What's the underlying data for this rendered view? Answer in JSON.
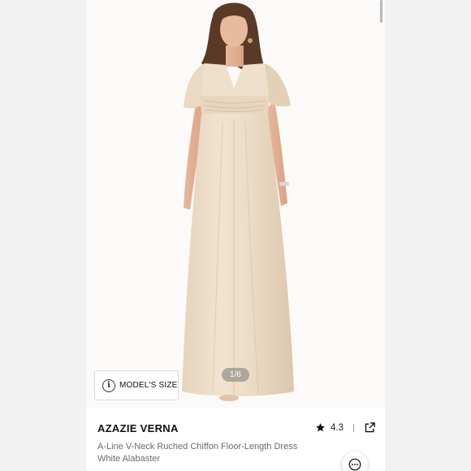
{
  "gallery": {
    "counter": "1/6",
    "model_size_label": "MODEL'S SIZE"
  },
  "product": {
    "title": "AZAZIE VERNA",
    "description_line1": "A-Line V-Neck Ruched Chiffon Floor-Length Dress",
    "description_line2": "White Alabaster",
    "rating": "4.3"
  },
  "icons": {
    "info": "info-icon",
    "star": "star-icon",
    "share": "share-external-icon",
    "chat": "chat-bubble-icon"
  },
  "colors": {
    "dress": "#ecdcc6",
    "background": "#f2f2f2",
    "text_primary": "#111111",
    "text_secondary": "#6b6b6b"
  }
}
